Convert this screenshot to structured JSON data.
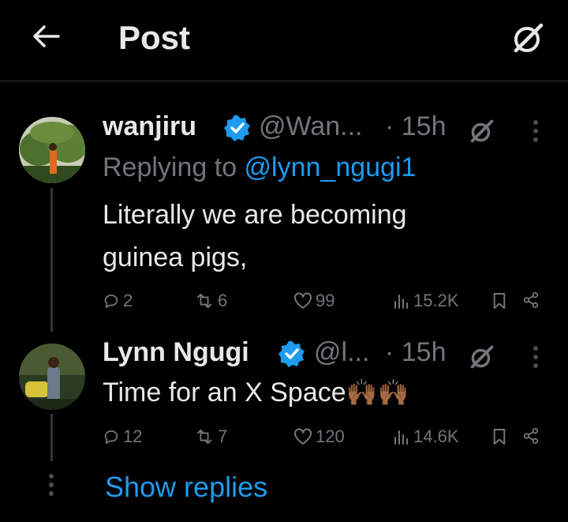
{
  "header": {
    "title": "Post"
  },
  "tweets": [
    {
      "name": "wanjiru",
      "handle": "@Wan...",
      "time": "· 15h",
      "replying_prefix": "Replying to ",
      "replying_to": "@lynn_ngugi1",
      "text_line1": "Literally we are becoming",
      "text_line2": "guinea pigs,",
      "replies": "2",
      "reposts": "6",
      "likes": "99",
      "views": "15.2K"
    },
    {
      "name": "Lynn Ngugi",
      "handle": "@l...",
      "time": "· 15h",
      "text_line1": "Time for an X Space",
      "emoji": "🙌🏾🙌🏾",
      "replies": "12",
      "reposts": "7",
      "likes": "120",
      "views": "14.6K"
    }
  ],
  "show_replies": "Show replies",
  "colors": {
    "accent": "#1d9bf0",
    "muted": "#71767b",
    "background": "#000000"
  },
  "icons": [
    "back-arrow-icon",
    "grok-icon",
    "verified-badge-icon",
    "more-icon",
    "reply-icon",
    "repost-icon",
    "like-icon",
    "views-icon",
    "bookmark-icon",
    "share-icon"
  ]
}
